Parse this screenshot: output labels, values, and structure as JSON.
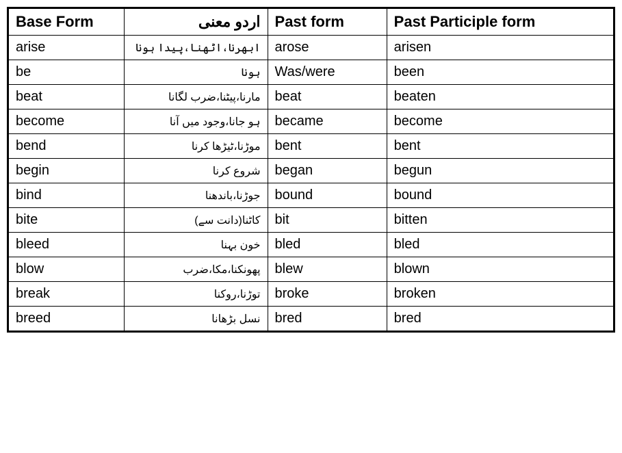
{
  "table": {
    "headers": {
      "base": "Base Form",
      "urdu": "اردو معنی",
      "past": "Past form",
      "participle": "Past Participle form"
    },
    "rows": [
      {
        "base": "arise",
        "urdu": "ابھرنا،اٹھنا،پیدا ہونا",
        "past": "arose",
        "participle": "arisen"
      },
      {
        "base": "be",
        "urdu": "ہونا",
        "past": "Was/were",
        "participle": "been"
      },
      {
        "base": "beat",
        "urdu": "مارنا،پیٹنا،ضرب لگانا",
        "past": "beat",
        "participle": "beaten"
      },
      {
        "base": "become",
        "urdu": "ہو جانا،وجود میں آنا",
        "past": "became",
        "participle": "become"
      },
      {
        "base": "bend",
        "urdu": "موڑنا،ٹیڑھا کرنا",
        "past": "bent",
        "participle": "bent"
      },
      {
        "base": "begin",
        "urdu": "شروع کرنا",
        "past": "began",
        "participle": "begun"
      },
      {
        "base": "bind",
        "urdu": "جوڑنا،باندھنا",
        "past": "bound",
        "participle": "bound"
      },
      {
        "base": "bite",
        "urdu": "کاٹنا(دانت سے)",
        "past": "bit",
        "participle": "bitten"
      },
      {
        "base": "bleed",
        "urdu": "خون بہنا",
        "past": "bled",
        "participle": "bled"
      },
      {
        "base": "blow",
        "urdu": "پھونکنا،مکا،ضرب",
        "past": "blew",
        "participle": "blown"
      },
      {
        "base": "break",
        "urdu": "توڑنا،روکنا",
        "past": "broke",
        "participle": "broken"
      },
      {
        "base": "breed",
        "urdu": "نسل بڑھانا",
        "past": "bred",
        "participle": "bred"
      }
    ]
  }
}
